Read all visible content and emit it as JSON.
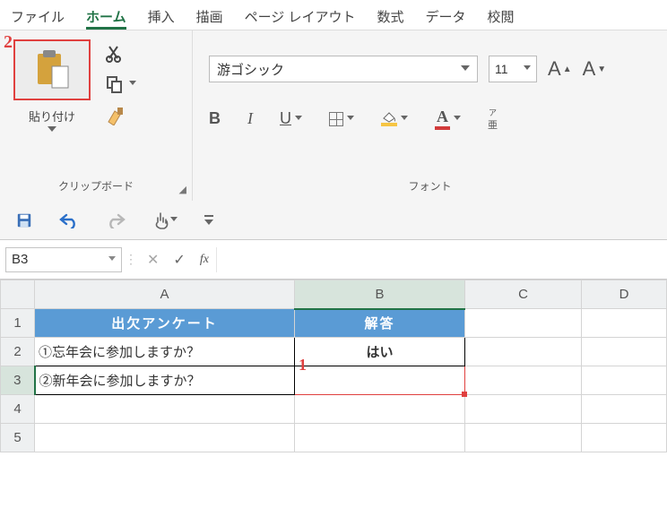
{
  "tabs": {
    "file": "ファイル",
    "home": "ホーム",
    "insert": "挿入",
    "draw": "描画",
    "layout": "ページ レイアウト",
    "formulas": "数式",
    "data": "データ",
    "review": "校閲"
  },
  "callouts": {
    "n1": "1",
    "n2": "2"
  },
  "clipboard": {
    "paste": "貼り付け",
    "group_title": "クリップボード"
  },
  "font": {
    "name": "游ゴシック",
    "size": "11",
    "group_title": "フォント",
    "bold": "B",
    "italic": "I",
    "underline": "U",
    "fontcolor_letter": "A",
    "ruby": "ア\n亜"
  },
  "grow_a": "A",
  "shrink_a": "A",
  "namebox": "B3",
  "fx": "fx",
  "columns": {
    "A": "A",
    "B": "B",
    "C": "C",
    "D": "D"
  },
  "rows": {
    "r1": "1",
    "r2": "2",
    "r3": "3",
    "r4": "4",
    "r5": "5"
  },
  "cells": {
    "A1": "出欠アンケート",
    "B1": "解答",
    "A2": "①忘年会に参加しますか？",
    "B2": "はい",
    "A3": "②新年会に参加しますか？",
    "B3": ""
  }
}
